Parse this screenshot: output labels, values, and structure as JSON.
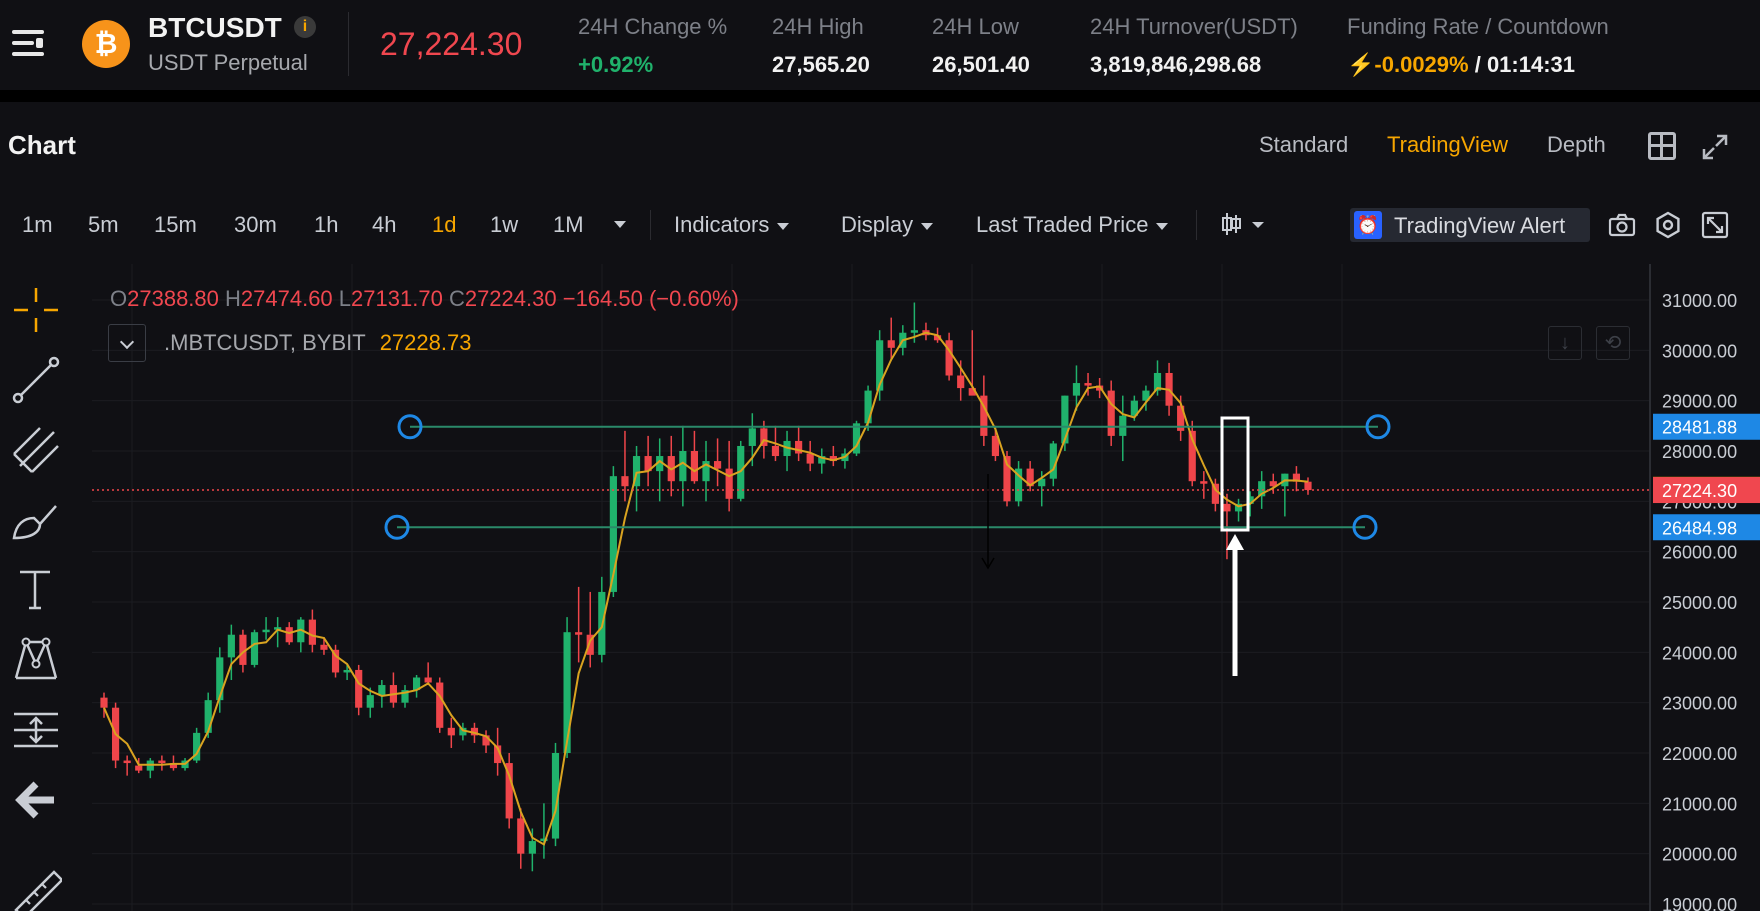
{
  "ticker": {
    "symbol": "BTCUSDT",
    "info_icon": "i",
    "subtitle": "USDT Perpetual",
    "last_price": "27,224.30",
    "coin_glyph": "₿",
    "stats": [
      {
        "label": "24H Change %",
        "value": "+0.92%",
        "tone": "green"
      },
      {
        "label": "24H High",
        "value": "27,565.20",
        "tone": "white"
      },
      {
        "label": "24H Low",
        "value": "26,501.40",
        "tone": "white"
      },
      {
        "label": "24H Turnover(USDT)",
        "value": "3,819,846,298.68",
        "tone": "white"
      }
    ],
    "funding_label": "Funding Rate / Countdown",
    "funding_bolt": "⚡",
    "funding_rate": "-0.0029%",
    "funding_sep": " / ",
    "countdown": "01:14:31"
  },
  "panel": {
    "title": "Chart",
    "views": [
      "Standard",
      "TradingView",
      "Depth"
    ],
    "active_view": "TradingView"
  },
  "toolbar": {
    "timeframes": [
      "1m",
      "5m",
      "15m",
      "30m",
      "1h",
      "4h",
      "1d",
      "1w",
      "1M"
    ],
    "active_timeframe": "1d",
    "indicators": "Indicators",
    "display": "Display",
    "price_type": "Last Traded Price",
    "alert": "TradingView Alert",
    "alert_icon": "⏰"
  },
  "legend": {
    "o_label": "O",
    "o": "27388.80",
    "h_label": "H",
    "h": "27474.60",
    "l_label": "L",
    "l": "27131.70",
    "c_label": "C",
    "c": "27224.30",
    "change": "−164.50 (−0.60%)",
    "series": ".MBTCUSDT, BYBIT",
    "series_value": "27228.73"
  },
  "chart_data": {
    "type": "candlestick",
    "y_axis_ticks": [
      31000,
      30000,
      29000,
      28000,
      27000,
      26000,
      25000,
      24000,
      23000,
      22000,
      21000,
      20000,
      19000
    ],
    "ylim": [
      19000,
      31300
    ],
    "price_tags": [
      {
        "value": "28481.88",
        "color": "#1e88e5"
      },
      {
        "value": "27228.73",
        "color": "#f7a600"
      },
      {
        "value": "27224.30",
        "color": "#f0474f"
      },
      {
        "value": "26484.98",
        "color": "#1e88e5"
      }
    ],
    "horizontal_lines": [
      28481.88,
      26484.98
    ],
    "last_price_line": 27224.3,
    "candles": [
      [
        23100,
        23200,
        22700,
        22900
      ],
      [
        22900,
        23000,
        21700,
        21850
      ],
      [
        21850,
        21950,
        21550,
        21800
      ],
      [
        21750,
        21900,
        21600,
        21650
      ],
      [
        21650,
        21900,
        21500,
        21850
      ],
      [
        21850,
        21950,
        21650,
        21800
      ],
      [
        21800,
        21950,
        21650,
        21700
      ],
      [
        21700,
        21900,
        21650,
        21850
      ],
      [
        21850,
        22500,
        21800,
        22400
      ],
      [
        22400,
        23200,
        22300,
        23050
      ],
      [
        23050,
        24100,
        22800,
        23900
      ],
      [
        23900,
        24550,
        23450,
        24350
      ],
      [
        24350,
        24450,
        23600,
        23750
      ],
      [
        23750,
        24450,
        23700,
        24400
      ],
      [
        24400,
        24700,
        24250,
        24450
      ],
      [
        24450,
        24700,
        24100,
        24500
      ],
      [
        24500,
        24600,
        24150,
        24200
      ],
      [
        24200,
        24700,
        24000,
        24650
      ],
      [
        24650,
        24850,
        24000,
        24150
      ],
      [
        24150,
        24300,
        23950,
        24050
      ],
      [
        24050,
        24150,
        23500,
        23600
      ],
      [
        23600,
        23750,
        23450,
        23650
      ],
      [
        23650,
        23750,
        22750,
        22900
      ],
      [
        22900,
        23300,
        22700,
        23150
      ],
      [
        23150,
        23450,
        22900,
        23350
      ],
      [
        23350,
        23600,
        22900,
        23000
      ],
      [
        23000,
        23350,
        22900,
        23250
      ],
      [
        23250,
        23550,
        23100,
        23500
      ],
      [
        23500,
        23800,
        23350,
        23400
      ],
      [
        23400,
        23500,
        22400,
        22500
      ],
      [
        22500,
        22700,
        22100,
        22350
      ],
      [
        22350,
        22600,
        22250,
        22500
      ],
      [
        22500,
        22600,
        22200,
        22350
      ],
      [
        22350,
        22450,
        22000,
        22150
      ],
      [
        22150,
        22500,
        21550,
        21800
      ],
      [
        21800,
        22000,
        20500,
        20700
      ],
      [
        20700,
        20900,
        19700,
        20000
      ],
      [
        20000,
        20500,
        19650,
        20250
      ],
      [
        20250,
        21000,
        19900,
        20300
      ],
      [
        20300,
        22200,
        20150,
        22000
      ],
      [
        22000,
        24700,
        21900,
        24400
      ],
      [
        24400,
        25300,
        23800,
        24350
      ],
      [
        24350,
        25200,
        23700,
        23950
      ],
      [
        23950,
        25500,
        23800,
        25200
      ],
      [
        25200,
        27700,
        25100,
        27500
      ],
      [
        27500,
        28400,
        27000,
        27300
      ],
      [
        27300,
        28100,
        26800,
        27900
      ],
      [
        27900,
        28300,
        27300,
        27600
      ],
      [
        27600,
        28250,
        27000,
        27900
      ],
      [
        27900,
        28300,
        27100,
        27400
      ],
      [
        27400,
        28500,
        26900,
        28000
      ],
      [
        28000,
        28400,
        27350,
        27400
      ],
      [
        27400,
        28200,
        27000,
        27800
      ],
      [
        27800,
        28250,
        27300,
        27650
      ],
      [
        27650,
        28200,
        26800,
        27050
      ],
      [
        27050,
        28200,
        27000,
        28100
      ],
      [
        28100,
        28750,
        27700,
        28450
      ],
      [
        28450,
        28600,
        27850,
        28100
      ],
      [
        28100,
        28500,
        27800,
        27900
      ],
      [
        27900,
        28400,
        27600,
        28200
      ],
      [
        28200,
        28500,
        27800,
        27950
      ],
      [
        27950,
        28200,
        27600,
        27750
      ],
      [
        27750,
        28050,
        27550,
        27900
      ],
      [
        27900,
        28100,
        27700,
        27800
      ],
      [
        27800,
        28050,
        27650,
        27950
      ],
      [
        27950,
        28600,
        27900,
        28550
      ],
      [
        28550,
        29300,
        28400,
        29200
      ],
      [
        29200,
        30400,
        29000,
        30200
      ],
      [
        30200,
        30650,
        29800,
        30050
      ],
      [
        30050,
        30500,
        29900,
        30350
      ],
      [
        30350,
        30950,
        30150,
        30400
      ],
      [
        30400,
        30550,
        30200,
        30300
      ],
      [
        30300,
        30450,
        30150,
        30200
      ],
      [
        30200,
        30350,
        29400,
        29500
      ],
      [
        29500,
        29800,
        29000,
        29250
      ],
      [
        29250,
        30400,
        29200,
        29100
      ],
      [
        29100,
        29500,
        28100,
        28300
      ],
      [
        28300,
        28500,
        27800,
        27900
      ],
      [
        27900,
        28000,
        26900,
        27000
      ],
      [
        27000,
        27800,
        26900,
        27650
      ],
      [
        27650,
        27800,
        27200,
        27300
      ],
      [
        27300,
        27600,
        26900,
        27450
      ],
      [
        27450,
        28200,
        27300,
        28150
      ],
      [
        28150,
        29100,
        28000,
        29100
      ],
      [
        29100,
        29700,
        28800,
        29350
      ],
      [
        29350,
        29550,
        29100,
        29300
      ],
      [
        29300,
        29450,
        29050,
        29200
      ],
      [
        29200,
        29400,
        28100,
        28300
      ],
      [
        28300,
        29100,
        27800,
        28700
      ],
      [
        28700,
        29100,
        28600,
        29000
      ],
      [
        29000,
        29300,
        28800,
        29200
      ],
      [
        29200,
        29800,
        29100,
        29550
      ],
      [
        29550,
        29750,
        28700,
        28900
      ],
      [
        28900,
        29100,
        28200,
        28400
      ],
      [
        28400,
        28600,
        27300,
        27400
      ],
      [
        27400,
        27600,
        27050,
        27350
      ],
      [
        27350,
        27450,
        26800,
        26950
      ],
      [
        26950,
        27150,
        25850,
        26800
      ],
      [
        26800,
        27050,
        26600,
        26950
      ],
      [
        26950,
        27200,
        26700,
        27100
      ],
      [
        27100,
        27600,
        26850,
        27400
      ],
      [
        27400,
        27550,
        27150,
        27300
      ],
      [
        27300,
        27550,
        26700,
        27550
      ],
      [
        27550,
        27700,
        27200,
        27390
      ],
      [
        27390,
        27475,
        27130,
        27224
      ]
    ]
  }
}
